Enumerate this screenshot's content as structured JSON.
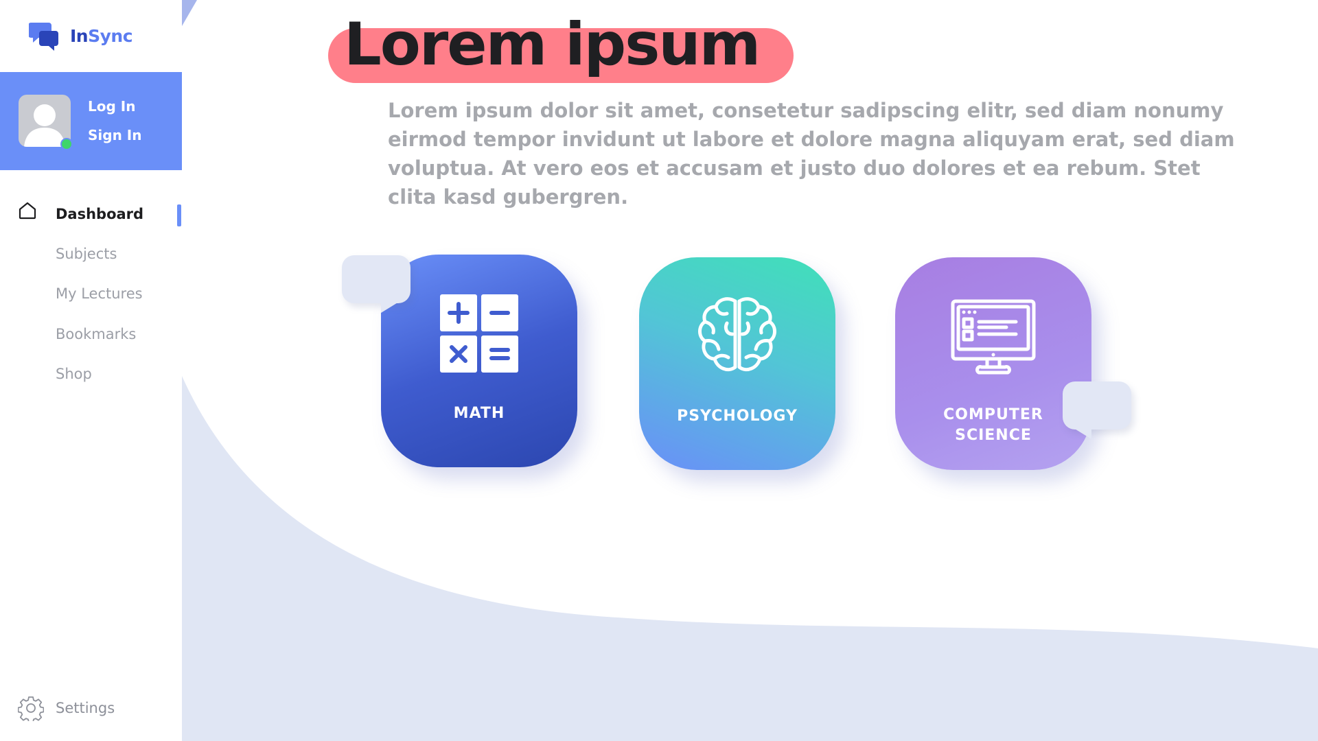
{
  "brand": {
    "name_part1": "In",
    "name_part2": "Sync",
    "icon": "chat-bubbles-icon"
  },
  "user": {
    "login_label": "Log In",
    "signin_label": "Sign In",
    "avatar_icon": "user-avatar-icon",
    "status": "online"
  },
  "sidebar": {
    "items": [
      {
        "label": "Dashboard",
        "icon": "home-icon",
        "active": true
      },
      {
        "label": "Subjects"
      },
      {
        "label": "My Lectures"
      },
      {
        "label": "Bookmarks"
      },
      {
        "label": "Shop"
      }
    ],
    "settings_label": "Settings",
    "settings_icon": "gear-icon"
  },
  "main": {
    "title": "Lorem ipsum",
    "description": "Lorem ipsum dolor sit amet, consetetur sadipscing elitr, sed diam nonumy eirmod tempor invidunt ut labore et dolore magna aliquyam erat, sed diam voluptua. At vero eos et accusam et justo duo dolores et ea rebum. Stet clita kasd gubergren.",
    "cards": [
      {
        "label": "MATH",
        "icon": "calculator-icon"
      },
      {
        "label": "PSYCHOLOGY",
        "icon": "brain-icon"
      },
      {
        "label_line1": "COMPUTER",
        "label_line2": "SCIENCE",
        "icon": "computer-monitor-icon"
      }
    ]
  },
  "colors": {
    "accent": "#6a8ff8",
    "brand_dark": "#2a44b8",
    "title_highlight": "#ff7f8a",
    "background_curve": "#e0e6f4",
    "online": "#3ed66a"
  }
}
